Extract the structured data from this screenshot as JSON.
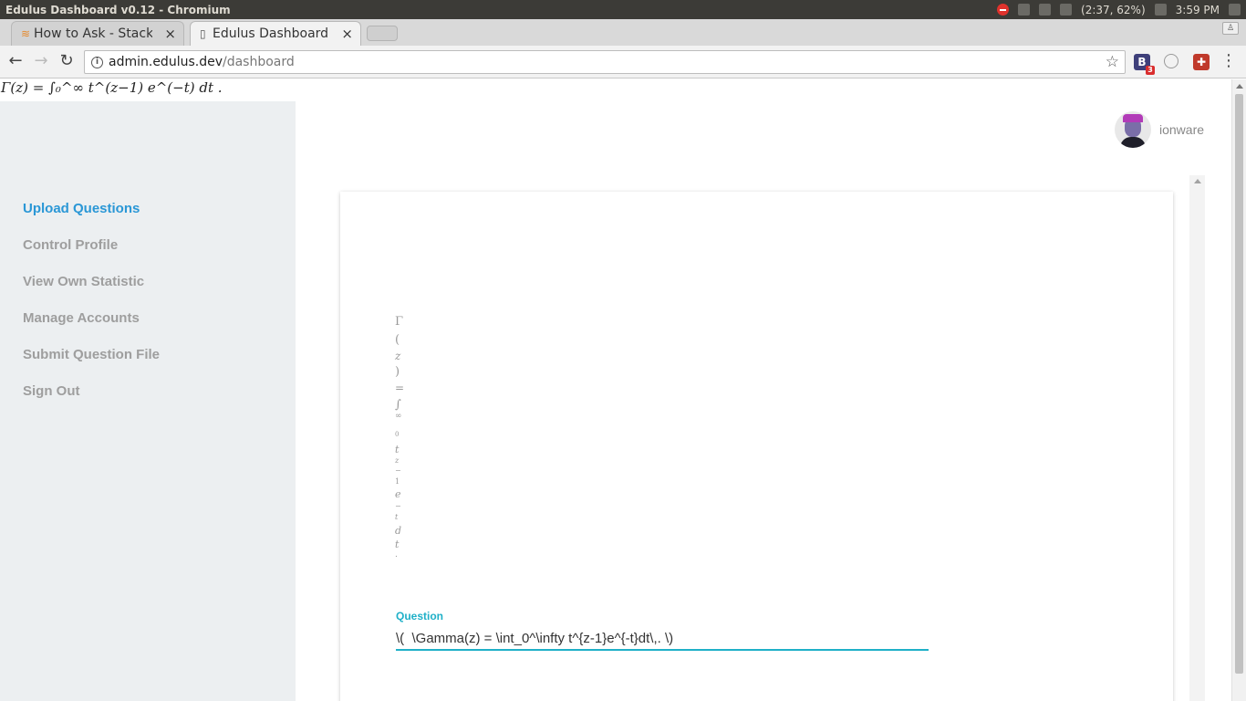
{
  "os": {
    "window_title": "Edulus Dashboard v0.12 - Chromium",
    "battery": "(2:37, 62%)",
    "clock": "3:59 PM"
  },
  "tabs": [
    {
      "label": "How to Ask - Stack O",
      "icon": "stackoverflow-icon",
      "close": "×"
    },
    {
      "label": "Edulus Dashboard v",
      "icon": "page-icon",
      "close": "×"
    }
  ],
  "toolbar": {
    "back": "←",
    "forward": "→",
    "reload": "↻",
    "url_host": "admin.edulus.dev",
    "url_path": "/dashboard",
    "info": "i",
    "star": "☆",
    "ext_b_label": "B",
    "ext_b_badge": "3",
    "menu": "⋮"
  },
  "math_rendered_top": "Γ(z) = ∫₀^∞ t^(z−1) e^(−t) dt .",
  "sidebar": {
    "items": [
      {
        "label": "Upload Questions",
        "active": true
      },
      {
        "label": "Control Profile",
        "active": false
      },
      {
        "label": "View Own Statistic",
        "active": false
      },
      {
        "label": "Manage Accounts",
        "active": false
      },
      {
        "label": "Submit Question File",
        "active": false
      },
      {
        "label": "Sign Out",
        "active": false
      }
    ]
  },
  "user": {
    "name": "ionware"
  },
  "preview_math_glyphs": [
    "Γ",
    "(",
    "z",
    ")",
    "=",
    "∫",
    "∞",
    "0",
    "t",
    "z",
    "−",
    "1",
    "e",
    "−",
    "t",
    "d",
    "t",
    "."
  ],
  "question": {
    "label": "Question",
    "value": "\\(  \\Gamma(z) = \\int_0^\\infty t^{z-1}e^{-t}dt\\,. \\)"
  },
  "colors": {
    "accent": "#2a97d6",
    "input_accent": "#1fb0c8",
    "sidebar_bg": "#eceff1",
    "nav_inactive": "#9e9e9e"
  }
}
